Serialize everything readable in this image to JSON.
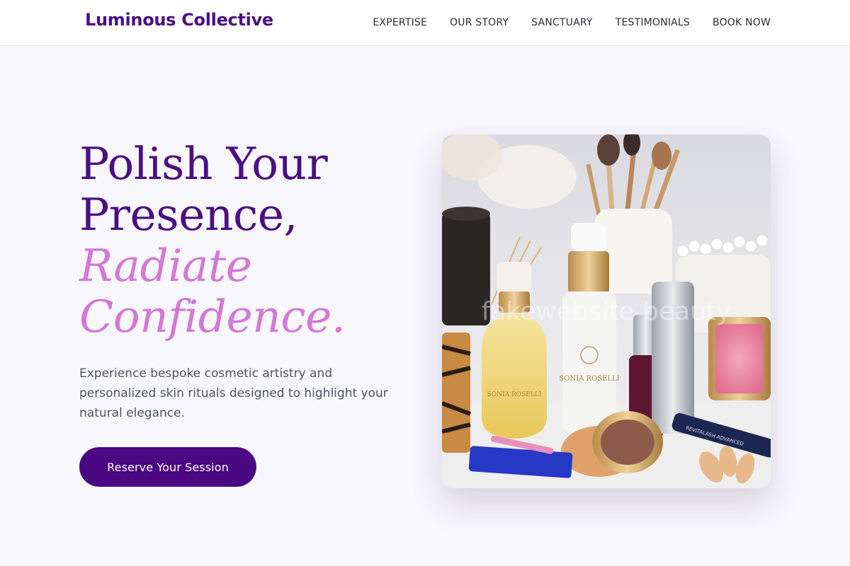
{
  "brand": {
    "name": "Luminous Collective"
  },
  "nav": {
    "items": [
      {
        "label": "EXPERTISE"
      },
      {
        "label": "OUR STORY"
      },
      {
        "label": "SANCTUARY"
      },
      {
        "label": "TESTIMONIALS"
      },
      {
        "label": "BOOK NOW"
      }
    ]
  },
  "hero": {
    "headline_line1": "Polish Your",
    "headline_line2": "Presence,",
    "headline_accent1": "Radiate",
    "headline_accent2": "Confidence.",
    "description": "Experience bespoke cosmetic artistry and personalized skin rituals designed to highlight your natural elegance.",
    "cta_label": "Reserve Your Session",
    "image": {
      "watermark": "fakewebsite beauty",
      "bottle_label_1": "SONIA ROSELLI",
      "bottle_label_2": "SONIA ROSELLI",
      "mascara_label": "REVITALASH ADVANCED"
    }
  },
  "colors": {
    "brand_purple": "#4b0f82",
    "accent_pink": "#d478d6",
    "button_bg": "#4b0682",
    "page_bg": "#f8f7fc"
  }
}
